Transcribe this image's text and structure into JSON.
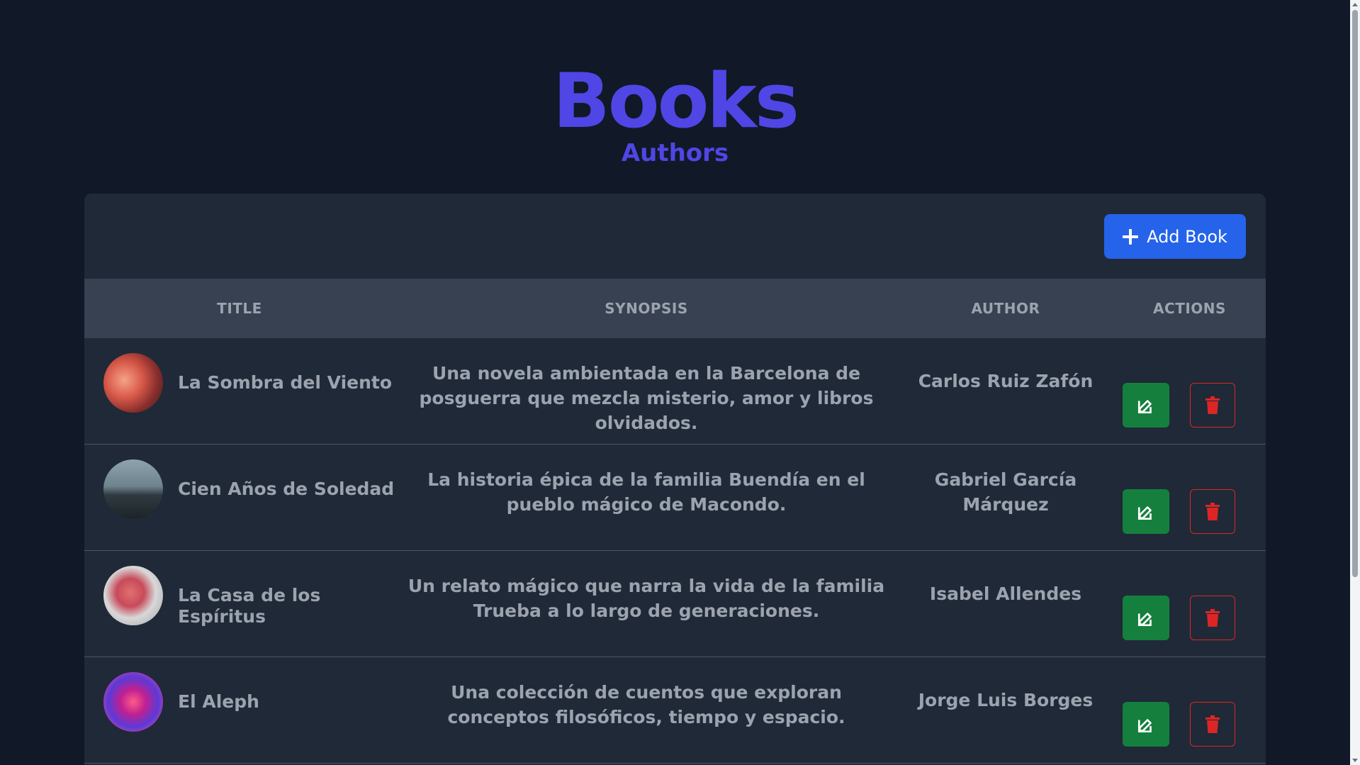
{
  "header": {
    "title": "Books",
    "subtitle": "Authors"
  },
  "toolbar": {
    "add_label": "Add Book"
  },
  "table": {
    "columns": [
      "TITLE",
      "SYNOPSIS",
      "AUTHOR",
      "ACTIONS"
    ],
    "rows": [
      {
        "title": "La Sombra del Viento",
        "synopsis": "Una novela ambientada en la Barcelona de posguerra que mezcla misterio, amor y libros olvidados.",
        "author": "Carlos Ruiz Zafón"
      },
      {
        "title": "Cien Años de Soledad",
        "synopsis": "La historia épica de la familia Buendía en el pueblo mágico de Macondo.",
        "author": "Gabriel García Márquez"
      },
      {
        "title": "La Casa de los Espíritus",
        "synopsis": "Un relato mágico que narra la vida de la familia Trueba a lo largo de generaciones.",
        "author": "Isabel Allendes"
      },
      {
        "title": "El Aleph",
        "synopsis": "Una colección de cuentos que exploran conceptos filosóficos, tiempo y espacio.",
        "author": "Jorge Luis Borges"
      }
    ]
  },
  "icons": {
    "add": "plus-icon",
    "edit": "edit-icon",
    "delete": "trash-icon"
  },
  "colors": {
    "background": "#111827",
    "accent": "#4f46e5",
    "primary_button": "#2563eb",
    "edit_button": "#15803d",
    "delete_button": "#dc2626"
  }
}
